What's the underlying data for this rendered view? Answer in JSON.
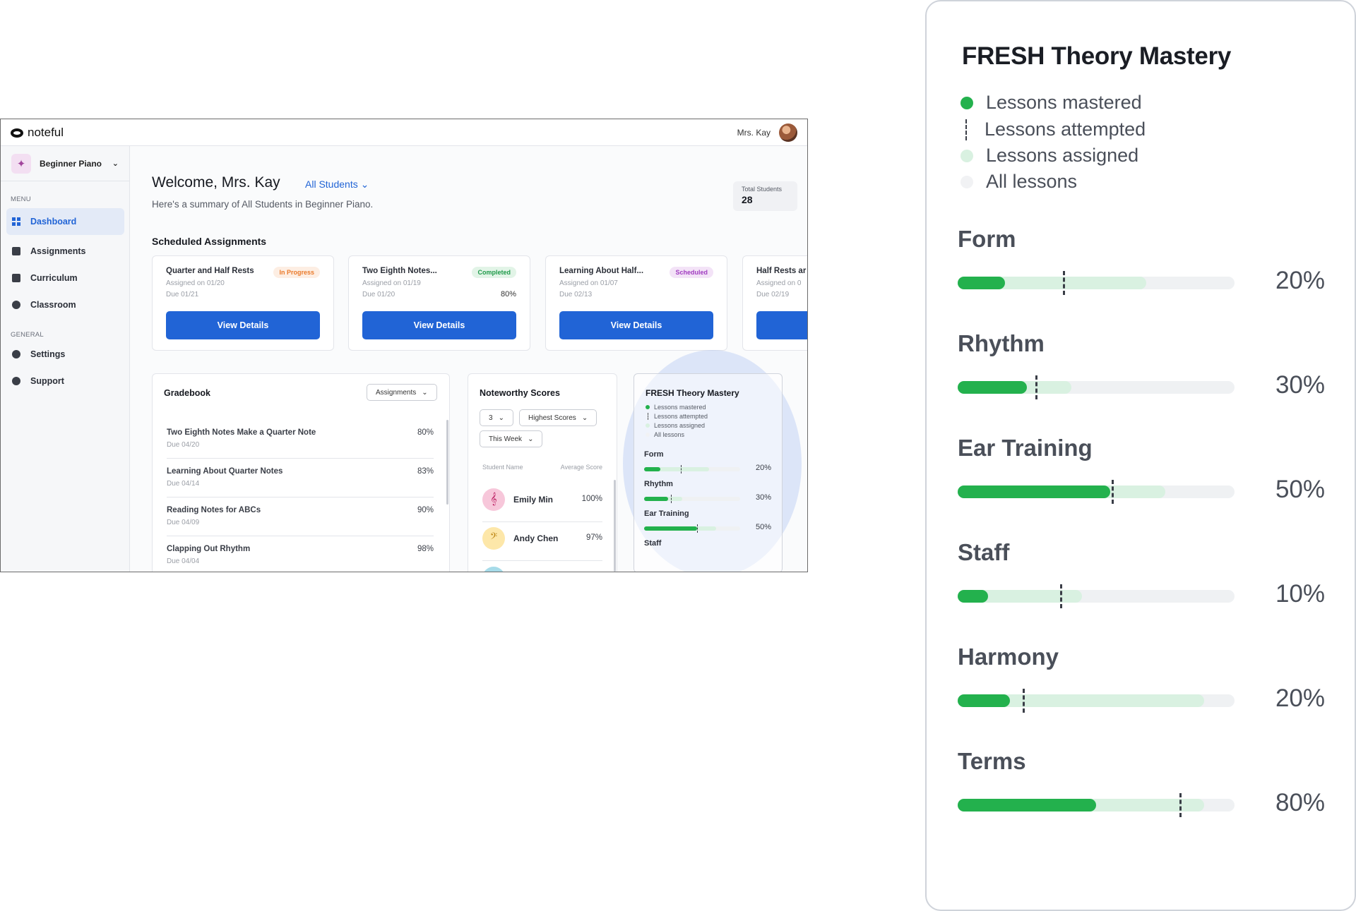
{
  "app": {
    "brand": "noteful",
    "user_name": "Mrs. Kay",
    "course": "Beginner Piano",
    "menu_label": "MENU",
    "general_label": "GENERAL",
    "nav": [
      {
        "label": "Dashboard",
        "icon": "dashboard-icon",
        "active": true
      },
      {
        "label": "Assignments",
        "icon": "assignments-icon",
        "active": false
      },
      {
        "label": "Curriculum",
        "icon": "curriculum-icon",
        "active": false
      },
      {
        "label": "Classroom",
        "icon": "classroom-icon",
        "active": false
      }
    ],
    "general": [
      {
        "label": "Settings",
        "icon": "gear-icon"
      },
      {
        "label": "Support",
        "icon": "support-icon"
      }
    ]
  },
  "header": {
    "welcome": "Welcome, Mrs. Kay",
    "filter": "All Students",
    "summary": "Here's a summary of All Students in Beginner Piano.",
    "total_label": "Total Students",
    "total_value": "28"
  },
  "scheduled": {
    "title": "Scheduled Assignments",
    "button_label": "View Details",
    "cards": [
      {
        "title": "Quarter and Half Rests",
        "assigned": "Assigned on 01/20",
        "due": "Due 01/21",
        "badge": "In Progress",
        "score": ""
      },
      {
        "title": "Two Eighth Notes...",
        "assigned": "Assigned on 01/19",
        "due": "Due 01/20",
        "badge": "Completed",
        "score": "80%"
      },
      {
        "title": "Learning About Half...",
        "assigned": "Assigned on 01/07",
        "due": "Due 02/13",
        "badge": "Scheduled",
        "score": ""
      },
      {
        "title": "Half Rests ar",
        "assigned": "Assigned on 0",
        "due": "Due 02/19",
        "badge": "",
        "score": ""
      }
    ]
  },
  "gradebook": {
    "title": "Gradebook",
    "dropdown": "Assignments",
    "rows": [
      {
        "name": "Two Eighth Notes Make a Quarter Note",
        "due": "Due 04/20",
        "score": "80%"
      },
      {
        "name": "Learning About Quarter Notes",
        "due": "Due 04/14",
        "score": "83%"
      },
      {
        "name": "Reading Notes for ABCs",
        "due": "Due 04/09",
        "score": "90%"
      },
      {
        "name": "Clapping Out Rhythm",
        "due": "Due 04/04",
        "score": "98%"
      }
    ]
  },
  "scores": {
    "title": "Noteworthy Scores",
    "count": "3",
    "sort": "Highest Scores",
    "period": "This Week",
    "col_name": "Student Name",
    "col_score": "Average Score",
    "students": [
      {
        "name": "Emily Min",
        "score": "100%",
        "icon": "treble-clef-icon",
        "color": "#f7c7da",
        "glyph": "𝄞"
      },
      {
        "name": "Andy Chen",
        "score": "97%",
        "icon": "bass-clef-icon",
        "color": "#fde7a9",
        "glyph": "𝄢"
      }
    ]
  },
  "mastery": {
    "title": "FRESH Theory Mastery",
    "legend": [
      {
        "label": "Lessons mastered",
        "kind": "dot",
        "color": "#23b14d"
      },
      {
        "label": "Lessons attempted",
        "kind": "dash",
        "color": "#3a3e47"
      },
      {
        "label": "Lessons assigned",
        "kind": "dot",
        "color": "#d9f1e1"
      },
      {
        "label": "All lessons",
        "kind": "dot",
        "color": "#f1f2f4"
      }
    ],
    "mini_rows": [
      {
        "label": "Form",
        "percent": "20%",
        "mastered": 0.17,
        "attempted": 0.38,
        "assigned": 0.68
      },
      {
        "label": "Rhythm",
        "percent": "30%",
        "mastered": 0.25,
        "attempted": 0.28,
        "assigned": 0.4
      },
      {
        "label": "Ear Training",
        "percent": "50%",
        "mastered": 0.55,
        "attempted": 0.55,
        "assigned": 0.75
      },
      {
        "label": "Staff",
        "percent": "",
        "mastered": 0,
        "attempted": 0,
        "assigned": 0
      }
    ],
    "rows": [
      {
        "label": "Form",
        "percent": "20%",
        "mastered": 0.17,
        "attempted": 0.38,
        "assigned": 0.68
      },
      {
        "label": "Rhythm",
        "percent": "30%",
        "mastered": 0.25,
        "attempted": 0.28,
        "assigned": 0.41
      },
      {
        "label": "Ear Training",
        "percent": "50%",
        "mastered": 0.55,
        "attempted": 0.555,
        "assigned": 0.75
      },
      {
        "label": "Staff",
        "percent": "10%",
        "mastered": 0.11,
        "attempted": 0.37,
        "assigned": 0.45
      },
      {
        "label": "Harmony",
        "percent": "20%",
        "mastered": 0.19,
        "attempted": 0.235,
        "assigned": 0.89
      },
      {
        "label": "Terms",
        "percent": "80%",
        "mastered": 0.5,
        "attempted": 0.8,
        "assigned": 0.89
      }
    ]
  },
  "colors": {
    "accent": "#2164d6",
    "mastered": "#23b14d",
    "assigned": "#d9f1e1",
    "in_progress_bg": "#fdeee3",
    "in_progress_fg": "#ea7a2b",
    "completed_bg": "#e2f4e7",
    "completed_fg": "#1f9a4a",
    "scheduled_bg": "#f3e3f7",
    "scheduled_fg": "#a03cc0"
  }
}
